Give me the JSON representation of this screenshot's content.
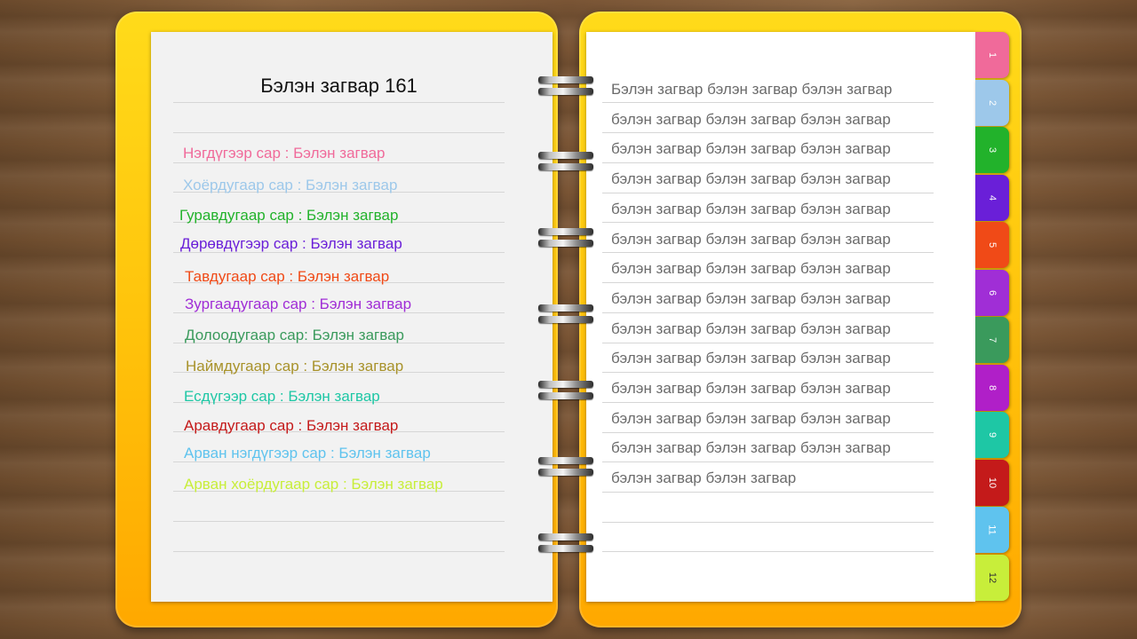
{
  "left_page": {
    "title": "Бэлэн загвар 161",
    "months": [
      {
        "text": "Нэгдүгээр сар : Бэлэн загвар",
        "color": "#f06a9a"
      },
      {
        "text": "Хоёрдугаар сар : Бэлэн загвар",
        "color": "#9dc8ea"
      },
      {
        "text": "Гуравдугаар сар : Бэлэн загвар",
        "color": "#22b22b"
      },
      {
        "text": "Дөрөвдүгээр сар : Бэлэн загвар",
        "color": "#6a1fd8"
      },
      {
        "text": "Тавдугаар сар : Бэлэн загвар",
        "color": "#f04a17"
      },
      {
        "text": "Зургаадугаар сар : Бэлэн загвар",
        "color": "#a02ed6"
      },
      {
        "text": "Долоодугаар сар: Бэлэн загвар",
        "color": "#3a9a5c"
      },
      {
        "text": "Наймдугаар сар : Бэлэн загвар",
        "color": "#a8922a"
      },
      {
        "text": "Есдүгээр сар : Бэлэн загвар",
        "color": "#1ec7a5"
      },
      {
        "text": "Аравдугаар сар : Бэлэн загвар",
        "color": "#c41a1a"
      },
      {
        "text": "Арван нэгдүгээр сар : Бэлэн загвар",
        "color": "#5fc3ee"
      },
      {
        "text": "Арван хоёрдугаар сар : Бэлэн загвар",
        "color": "#c8ee3a"
      }
    ]
  },
  "right_page": {
    "lines": [
      "Бэлэн загвар бэлэн загвар бэлэн загвар",
      "бэлэн загвар бэлэн загвар бэлэн загвар",
      "бэлэн загвар бэлэн загвар бэлэн загвар",
      "бэлэн загвар бэлэн загвар бэлэн загвар",
      "бэлэн загвар бэлэн загвар бэлэн загвар",
      "бэлэн загвар бэлэн загвар бэлэн загвар",
      "бэлэн загвар бэлэн загвар бэлэн загвар",
      "бэлэн загвар бэлэн загвар бэлэн загвар",
      "бэлэн загвар бэлэн загвар бэлэн загвар",
      "бэлэн загвар бэлэн загвар бэлэн загвар",
      "бэлэн загвар бэлэн загвар бэлэн загвар",
      "бэлэн загвар бэлэн загвар бэлэн загвар",
      "бэлэн загвар бэлэн загвар бэлэн загвар",
      "бэлэн загвар бэлэн загвар"
    ]
  },
  "tabs": [
    {
      "label": "1",
      "color": "#f06a9a"
    },
    {
      "label": "2",
      "color": "#9dc8ea"
    },
    {
      "label": "3",
      "color": "#22b22b"
    },
    {
      "label": "4",
      "color": "#6a1fd8"
    },
    {
      "label": "5",
      "color": "#f04a17"
    },
    {
      "label": "6",
      "color": "#a02ed6"
    },
    {
      "label": "7",
      "color": "#3a9a5c"
    },
    {
      "label": "8",
      "color": "#b01fc8"
    },
    {
      "label": "9",
      "color": "#1ec7a5"
    },
    {
      "label": "10",
      "color": "#c41a1a"
    },
    {
      "label": "11",
      "color": "#5fc3ee"
    },
    {
      "label": "12",
      "color": "#c8ee3a"
    }
  ],
  "colors": {
    "cover": "#ffc10a",
    "left_page": "#f2f2f2",
    "right_page": "#ffffff",
    "rule": "#d6d6d6"
  }
}
